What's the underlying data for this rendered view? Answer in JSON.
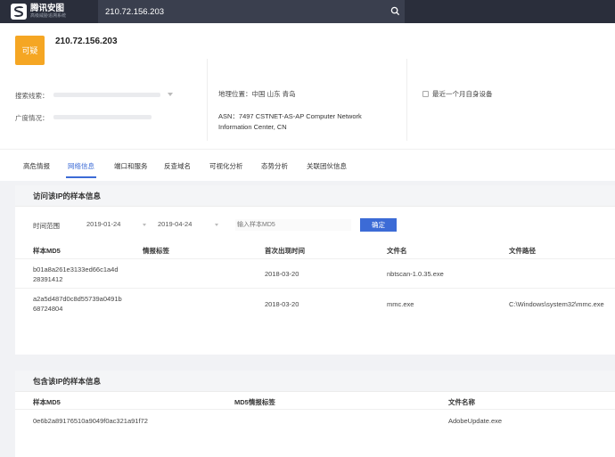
{
  "header": {
    "logo_title": "腾讯安图",
    "logo_subtitle": "高级威胁追溯系统",
    "search_value": "210.72.156.203"
  },
  "ip_card": {
    "badge": "可疑",
    "ip": "210.72.156.203",
    "intel_source_label": "搜索线索：",
    "wide_intel_label": "广度情况：",
    "geo": "地理位置：中国 山东 青岛",
    "asn": "ASN：7497 CSTNET-AS-AP Computer Network Information Center, CN",
    "recent_label": "最近一个月自身设备"
  },
  "tabs": [
    {
      "label": "高危情报"
    },
    {
      "label": "网络信息"
    },
    {
      "label": "端口和服务"
    },
    {
      "label": "反查域名"
    },
    {
      "label": "可视化分析"
    },
    {
      "label": "态势分析"
    },
    {
      "label": "关联团伙信息"
    }
  ],
  "visit_section": {
    "title": "访问该IP的样本信息",
    "time_label": "时间范围",
    "date_from": "2019-01-24",
    "date_to": "2019-04-24",
    "search_placeholder": "输入样本MD5",
    "confirm_label": "确定",
    "columns": [
      "样本MD5",
      "情报标签",
      "首次出现时间",
      "文件名",
      "文件路径"
    ],
    "rows": [
      {
        "md5_line1": "b01a8a261e3133ed66c1a4d",
        "md5_line2": "28391412",
        "tag": "",
        "first_seen": "2018-03-20",
        "filename": "nbtscan-1.0.35.exe",
        "path": ""
      },
      {
        "md5_line1": "a2a5d487d0c8d55739a0491b",
        "md5_line2": "68724804",
        "tag": "",
        "first_seen": "2018-03-20",
        "filename": "mmc.exe",
        "path": "C:\\Windows\\system32\\mmc.exe"
      }
    ]
  },
  "contain_section": {
    "title": "包含该IP的样本信息",
    "columns": [
      "样本MD5",
      "MD5情报标签",
      "文件名称"
    ],
    "rows": [
      {
        "md5": "0e6b2a89176510a9049f0ac321a91f72",
        "tag": "",
        "filename": "AdobeUpdate.exe"
      }
    ]
  }
}
